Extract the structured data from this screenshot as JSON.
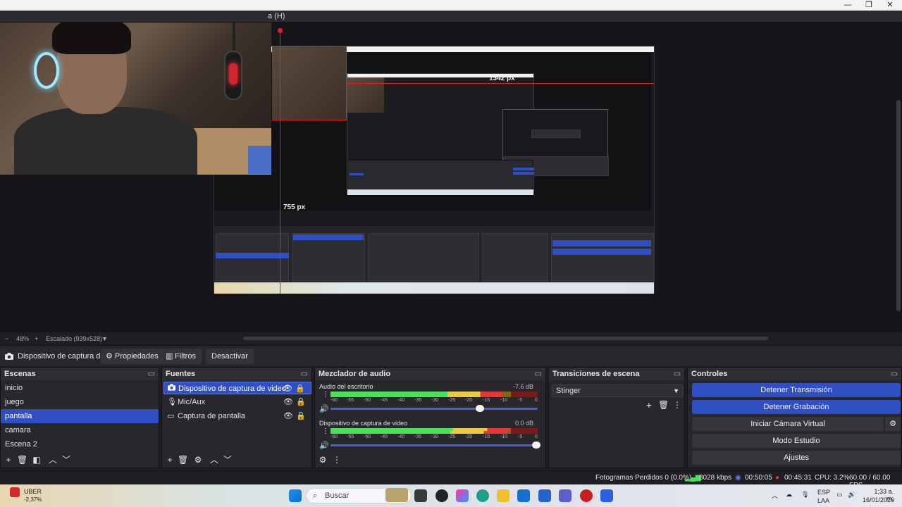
{
  "window": {
    "menu_item": "a (H)",
    "minimize": "—",
    "maximize": "❐",
    "close": "✕"
  },
  "preview": {
    "measure_horizontal": "1342 px",
    "measure_vertical": "755 px"
  },
  "preview_footer": {
    "minus": "−",
    "zoom": "48%",
    "plus": "+",
    "scale": "Escalado (939x528)",
    "caret": "▼"
  },
  "source_toolbar": {
    "source_name": "Dispositivo de captura de v",
    "properties_label": "Propiedades",
    "filters_label": "Filtros",
    "deactivate_label": "Desactivar"
  },
  "scenes": {
    "title": "Escenas",
    "items": [
      {
        "label": "inicio"
      },
      {
        "label": "juego"
      },
      {
        "label": "pantalla"
      },
      {
        "label": "camara"
      },
      {
        "label": "Escena 2"
      }
    ],
    "selected": "pantalla"
  },
  "sources": {
    "title": "Fuentes",
    "items": [
      {
        "label": "Dispositivo de captura de video",
        "icon": "camera-icon"
      },
      {
        "label": "Mic/Aux",
        "icon": "microphone-icon"
      },
      {
        "label": "Captura de pantalla",
        "icon": "monitor-icon"
      }
    ]
  },
  "mixer": {
    "title": "Mezclador de audio",
    "channels": [
      {
        "name": "Audio del escritorio",
        "db": "-7.6 dB",
        "level": 0.83,
        "volume": 0.7
      },
      {
        "name": "Dispositivo de captura de video",
        "db": "0.0 dB",
        "level": 0.87,
        "volume": 1.0
      }
    ],
    "ticks": [
      "-60",
      "-55",
      "-50",
      "-45",
      "-40",
      "-35",
      "-30",
      "-25",
      "-20",
      "-15",
      "-10",
      "-5",
      "0"
    ]
  },
  "transitions": {
    "title": "Transiciones de escena",
    "selected": "Stinger"
  },
  "controls": {
    "title": "Controles",
    "buttons": [
      {
        "label": "Detener Transmisión",
        "active": true
      },
      {
        "label": "Detener Grabación",
        "active": true
      },
      {
        "label": "Iniciar Cámara Virtual",
        "active": false
      },
      {
        "label": "Modo Estudio",
        "active": false
      },
      {
        "label": "Ajustes",
        "active": false
      }
    ]
  },
  "status": {
    "dropped_frames": "Fotogramas Perdidos 0 (0.0%)",
    "bitrate": "8028 kbps",
    "stream_time": "00:50:05",
    "record_time": "00:45:31",
    "cpu": "CPU: 3.2%",
    "fps": "60.00 / 60.00 FPS"
  },
  "taskbar": {
    "stock_name": "UBER",
    "stock_change": "-2,37%",
    "search_placeholder": "Buscar",
    "lang_top": "ESP",
    "lang_bottom": "LAA",
    "time": "1:33 a. m.",
    "date": "16/01/2026"
  },
  "colors": {
    "accent": "#2f4fc2",
    "dock_bg": "#27272c",
    "guide_red": "#e02028"
  }
}
